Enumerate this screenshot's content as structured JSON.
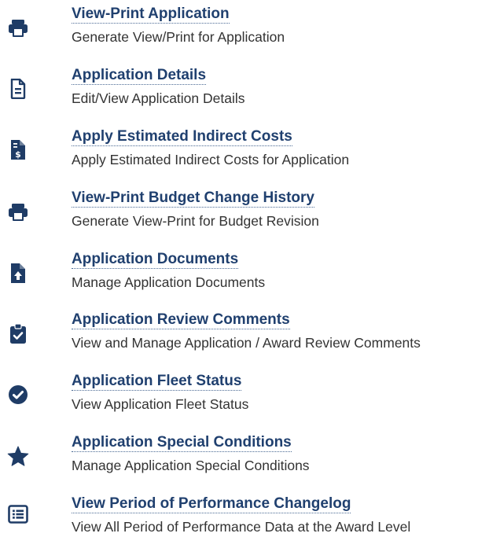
{
  "colors": {
    "icon": "#1f3c66",
    "link": "#20406f",
    "text": "#333333"
  },
  "items": [
    {
      "icon": "printer-icon",
      "title": "View-Print Application",
      "description": "Generate View/Print for Application"
    },
    {
      "icon": "document-icon",
      "title": "Application Details",
      "description": "Edit/View Application Details"
    },
    {
      "icon": "invoice-dollar-icon",
      "title": "Apply Estimated Indirect Costs",
      "description": "Apply Estimated Indirect Costs for Application"
    },
    {
      "icon": "printer-icon",
      "title": "View-Print Budget Change History",
      "description": "Generate View-Print for Budget Revision"
    },
    {
      "icon": "file-upload-icon",
      "title": "Application Documents",
      "description": "Manage Application Documents"
    },
    {
      "icon": "clipboard-check-icon",
      "title": "Application Review Comments",
      "description": "View and Manage Application / Award Review Comments"
    },
    {
      "icon": "check-circle-icon",
      "title": "Application Fleet Status",
      "description": "View Application Fleet Status"
    },
    {
      "icon": "star-icon",
      "title": "Application Special Conditions",
      "description": "Manage Application Special Conditions"
    },
    {
      "icon": "list-alt-icon",
      "title": "View Period of Performance Changelog",
      "description": "View All Period of Performance Data at the Award Level"
    }
  ]
}
